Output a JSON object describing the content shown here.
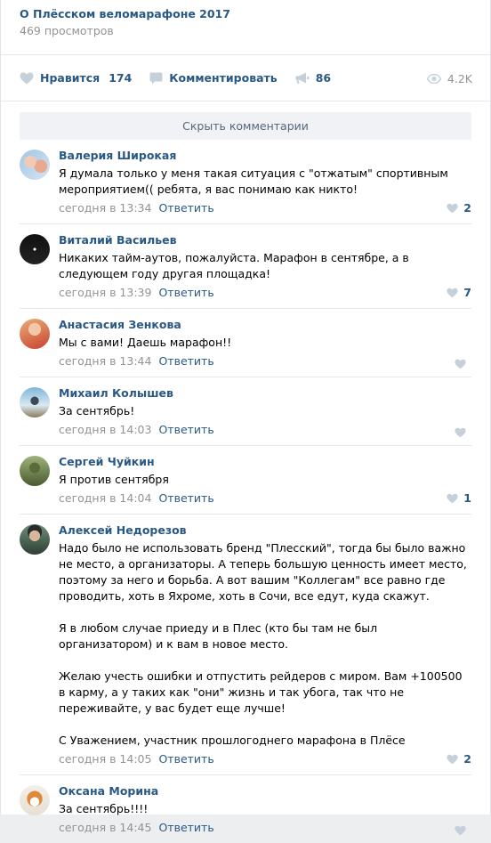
{
  "post": {
    "title": "О Плёсском веломарафоне 2017",
    "views_text": "469 просмотров"
  },
  "actions": {
    "like_label": "Нравится",
    "like_count": "174",
    "comment_label": "Комментировать",
    "share_count": "86",
    "views_count": "4.2K"
  },
  "hide_comments_label": "Скрыть комментарии",
  "colors": {
    "link": "#2a5885",
    "muted": "#939393",
    "icon": "#c5d0db"
  },
  "comments": [
    {
      "author": "Валерия Широкая",
      "paragraphs": [
        "Я думала только у меня такая ситуация с \"отжатым\" спортивным мероприятием(( ребята, я вас понимаю как никто!"
      ],
      "date": "сегодня в 13:34",
      "reply": "Ответить",
      "likes": "2"
    },
    {
      "author": "Виталий Васильев",
      "paragraphs": [
        "Никаких тайм-аутов, пожалуйста. Марафон в сентябре, а в следующем году другая площадка!"
      ],
      "date": "сегодня в 13:39",
      "reply": "Ответить",
      "likes": "7"
    },
    {
      "author": "Анастасия Зенкова",
      "paragraphs": [
        "Мы с вами! Даешь марафон!!"
      ],
      "date": "сегодня в 13:44",
      "reply": "Ответить",
      "likes": ""
    },
    {
      "author": "Михаил Колышев",
      "paragraphs": [
        "За сентябрь!"
      ],
      "date": "сегодня в 14:03",
      "reply": "Ответить",
      "likes": ""
    },
    {
      "author": "Сергей Чуйкин",
      "paragraphs": [
        "Я против сентября"
      ],
      "date": "сегодня в 14:04",
      "reply": "Ответить",
      "likes": "1"
    },
    {
      "author": "Алексей Недорезов",
      "paragraphs": [
        "Надо было не использовать бренд \"Плесский\", тогда бы было важно не место, а организаторы. А теперь большую ценность имеет место, поэтому за него и борьба. А вот вашим \"Коллегам\" все равно где проводить, хоть в Яхроме, хоть в Сочи, все едут, куда скажут.",
        "Я в любом случае приеду и в Плес (кто бы там не был организатором) и к вам в новое место.",
        "Желаю учесть ошибки и отпустить рейдеров с миром. Вам +100500 в карму, а у таких как \"они\" жизнь и так убога, так что не переживайте, у вас будет еще лучше!",
        "С Уважением, участник прошлогоднего марафона в Плёсе"
      ],
      "date": "сегодня в 14:05",
      "reply": "Ответить",
      "likes": "2"
    },
    {
      "author": "Оксана Морина",
      "paragraphs": [
        "За сентябрь!!!!"
      ],
      "date": "сегодня в 14:45",
      "reply": "Ответить",
      "likes": ""
    }
  ]
}
